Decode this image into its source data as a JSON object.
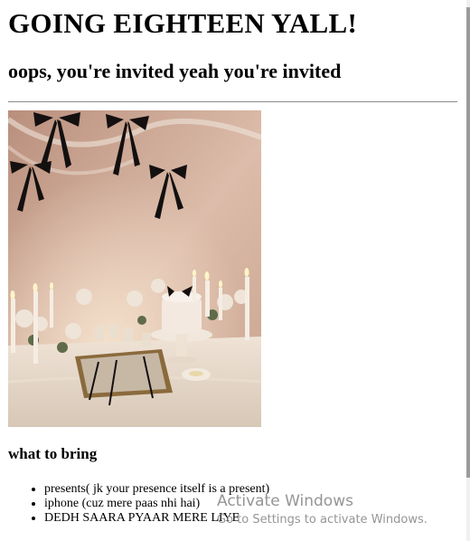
{
  "page": {
    "title": "GOING EIGHTEEN YALL!",
    "subtitle": "oops, you're invited yeah you're invited"
  },
  "photo": {
    "description_icon": "party-table-photo"
  },
  "bring": {
    "heading": "what to bring",
    "items": [
      "presents( jk your presence itself is a present)",
      "iphone (cuz mere paas nhi hai)",
      "DEDH SAARA PYAAR MERE LIYE"
    ]
  },
  "watermark": {
    "title": "Activate Windows",
    "subtitle": "Go to Settings to activate Windows."
  }
}
